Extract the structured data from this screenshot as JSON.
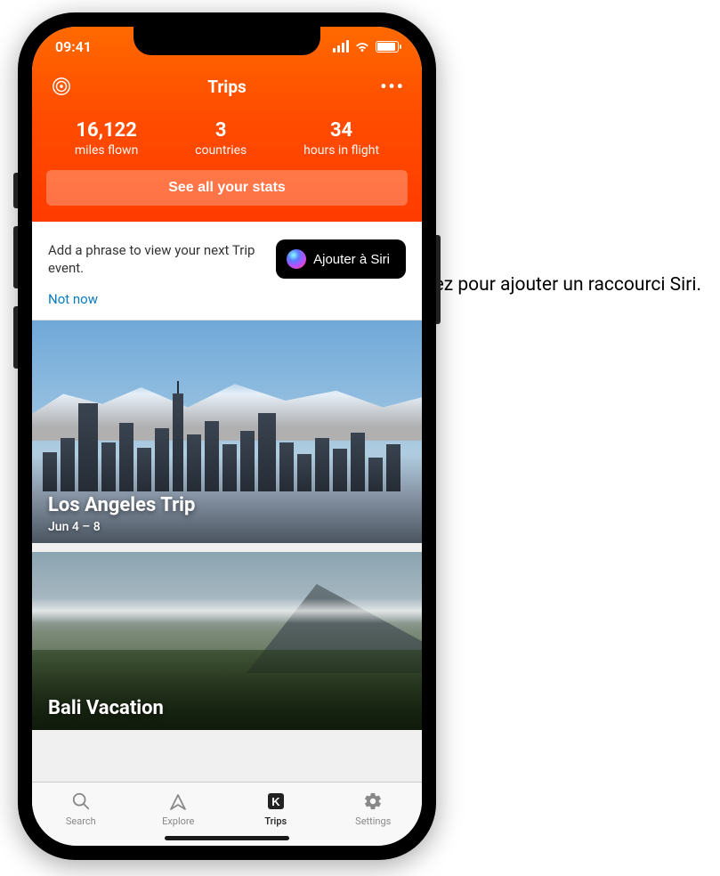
{
  "statusbar": {
    "time": "09:41"
  },
  "header": {
    "title": "Trips"
  },
  "stats": {
    "items": [
      {
        "value": "16,122",
        "label": "miles flown"
      },
      {
        "value": "3",
        "label": "countries"
      },
      {
        "value": "34",
        "label": "hours in flight"
      }
    ],
    "button": "See all your stats"
  },
  "siri": {
    "prompt": "Add a phrase to view your next Trip event.",
    "button": "Ajouter à Siri",
    "dismiss": "Not now"
  },
  "trips": [
    {
      "title": "Los Angeles Trip",
      "dates": "Jun 4 – 8"
    },
    {
      "title": "Bali Vacation",
      "dates": ""
    }
  ],
  "tabs": [
    {
      "label": "Search",
      "icon": "search"
    },
    {
      "label": "Explore",
      "icon": "explore"
    },
    {
      "label": "Trips",
      "icon": "trips",
      "active": true
    },
    {
      "label": "Settings",
      "icon": "settings"
    }
  ],
  "callout": {
    "text": "Touchez pour ajouter un raccourci Siri."
  }
}
